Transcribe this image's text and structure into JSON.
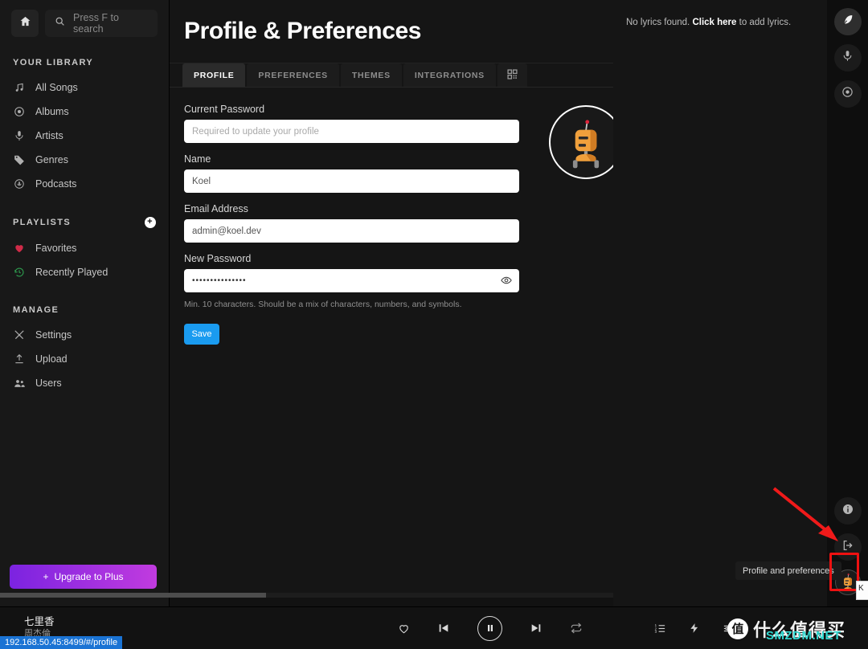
{
  "sidebar": {
    "home_icon": "home-icon",
    "search": {
      "placeholder": "Press F to search",
      "icon": "search-icon"
    },
    "library_heading": "YOUR LIBRARY",
    "library_items": [
      {
        "label": "All Songs",
        "icon": "music-note-icon"
      },
      {
        "label": "Albums",
        "icon": "disc-icon"
      },
      {
        "label": "Artists",
        "icon": "microphone-icon"
      },
      {
        "label": "Genres",
        "icon": "tag-icon"
      },
      {
        "label": "Podcasts",
        "icon": "podcast-icon"
      }
    ],
    "playlists_heading": "PLAYLISTS",
    "add_playlist_label": "+",
    "playlist_items": [
      {
        "label": "Favorites",
        "icon": "heart-icon",
        "color": "#d32f4b"
      },
      {
        "label": "Recently Played",
        "icon": "history-icon",
        "color": "#2e9e4f"
      }
    ],
    "manage_heading": "MANAGE",
    "manage_items": [
      {
        "label": "Settings",
        "icon": "tools-icon"
      },
      {
        "label": "Upload",
        "icon": "upload-icon"
      },
      {
        "label": "Users",
        "icon": "users-icon"
      }
    ],
    "upgrade_label": "Upgrade to Plus",
    "upgrade_plus": "+"
  },
  "main": {
    "title": "Profile & Preferences",
    "tabs": [
      {
        "label": "PROFILE",
        "active": true
      },
      {
        "label": "PREFERENCES",
        "active": false
      },
      {
        "label": "THEMES",
        "active": false
      },
      {
        "label": "INTEGRATIONS",
        "active": false
      },
      {
        "label": "",
        "icon": "qr-code-icon",
        "active": false
      }
    ],
    "fields": {
      "current_password": {
        "label": "Current Password",
        "value": "",
        "placeholder": "Required to update your profile"
      },
      "name": {
        "label": "Name",
        "value": "Koel",
        "placeholder": ""
      },
      "email": {
        "label": "Email Address",
        "value": "admin@koel.dev",
        "placeholder": ""
      },
      "new_password": {
        "label": "New Password",
        "value": "•••••••••••••••",
        "placeholder": "",
        "reveal_icon": "eye-icon"
      }
    },
    "password_hint": "Min. 10 characters. Should be a mix of characters, numbers, and symbols.",
    "save_label": "Save",
    "avatar_icon": "robot-avatar"
  },
  "right_panel": {
    "lyrics_prefix": "No lyrics found. ",
    "lyrics_link": "Click here",
    "lyrics_suffix": " to add lyrics."
  },
  "right_rail": {
    "top_buttons": [
      {
        "icon": "feather-lyrics-icon",
        "active": true
      },
      {
        "icon": "microphone-artist-icon",
        "active": false
      },
      {
        "icon": "disc-album-icon",
        "active": false
      }
    ],
    "bottom_buttons": [
      {
        "icon": "info-icon"
      },
      {
        "icon": "logout-icon"
      }
    ],
    "avatar_icon": "robot-avatar"
  },
  "annotations": {
    "tooltip_text": "Profile and preferences",
    "highlight_color": "#ee1111",
    "arrow_color": "#f01a1a",
    "mini_popup_text": "K"
  },
  "player": {
    "now_playing_title": "七里香",
    "now_playing_artist": "周杰倫",
    "controls": [
      {
        "icon": "heart-icon",
        "name": "like-button"
      },
      {
        "icon": "previous-icon",
        "name": "previous-button"
      },
      {
        "icon": "pause-icon",
        "name": "play-pause-button"
      },
      {
        "icon": "next-icon",
        "name": "next-button"
      },
      {
        "icon": "repeat-icon",
        "name": "repeat-button"
      }
    ],
    "right_controls": [
      {
        "icon": "queue-list-icon",
        "name": "queue-button"
      },
      {
        "icon": "lightning-icon",
        "name": "visualizer-button"
      },
      {
        "icon": "equalizer-icon",
        "name": "equalizer-button"
      }
    ]
  },
  "watermark": {
    "logo_char": "值",
    "text": "什么值得买",
    "net": "SMZDM.NET"
  },
  "statusbar": {
    "url": "192.168.50.45:8499/#/profile"
  }
}
